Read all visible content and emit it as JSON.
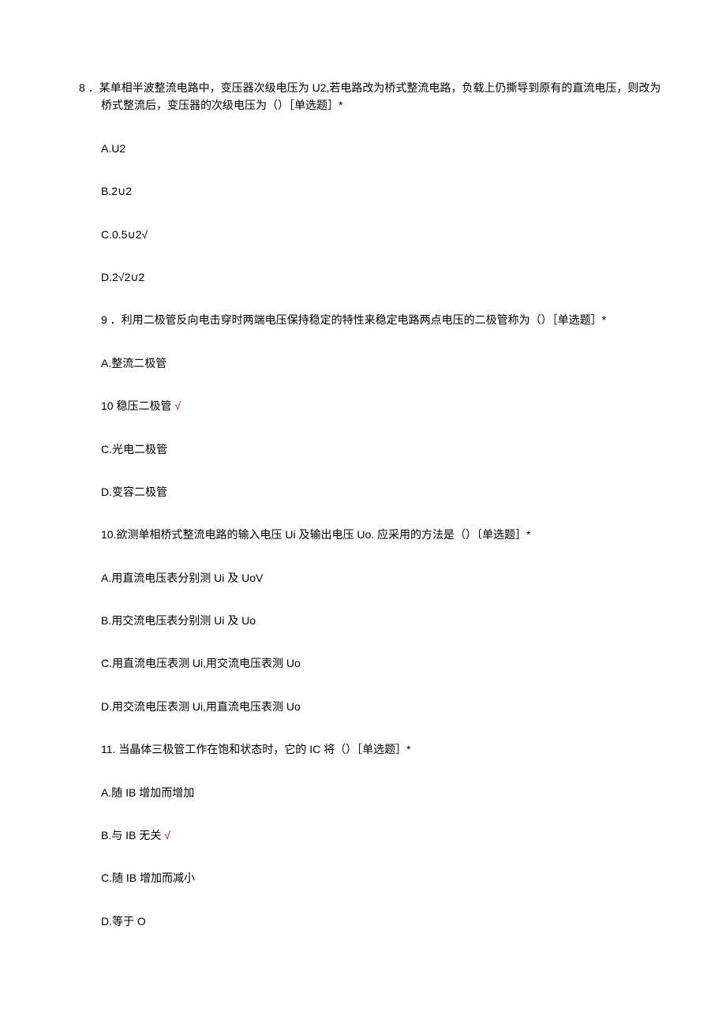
{
  "q8": {
    "text": "8 ．某单相半波整流电路中，变压器次级电压为 U2,若电路改为桥式整流电路，负载上仍撕导到原有的直流电压，则改为桥式整流后，变压器的次级电压为（）［单选题］*",
    "a": "A.U2",
    "b": "B.2∪2",
    "c": "C.0.5∪2√",
    "d": "D.2√2∪2"
  },
  "q9": {
    "text": "9 ．利用二极管反向电击穿时两端电压保持稳定的特性来稳定电路两点电压的二极管称为（）［单选题］*",
    "a": "A.整流二极管",
    "b_text": "10  稳压二极管 ",
    "b_mark": "√",
    "c": "C.光电二极管",
    "d": "D.变容二极管"
  },
  "q10": {
    "text": "10.欲测单相桥式整流电路的输入电压 Ui 及输出电压 Uo. 应采用的方法是（）〔单选题］*",
    "a": "A.用直流电压表分别测 Ui 及 UoV",
    "b": "B.用交流电压表分别测 Ui 及 Uo",
    "c": "C.用直流电压表测 Ui,用交流电压表测 Uo",
    "d": "D.用交流电压表测 Ui,用直流电压表测 Uo"
  },
  "q11": {
    "text": "11. 当晶体三极管工作在饱和状态时，它的 IC 将（）［单选题］*",
    "a": "A.随 IB 增加而增加",
    "b_text": "B.与 IB 无关 ",
    "b_mark": "√",
    "c": "C.随 IB 增加而减小",
    "d": "D.等于 O"
  }
}
